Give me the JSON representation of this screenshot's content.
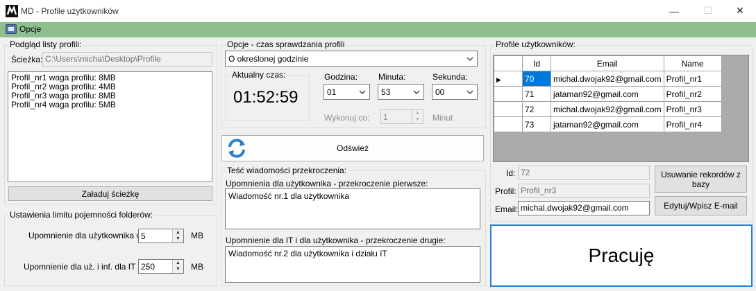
{
  "window": {
    "title": "MD - Profile użytkowników",
    "minimize_glyph": "—",
    "maximize_glyph": "☐",
    "close_glyph": "✕"
  },
  "menu": {
    "options_label": "Opcje"
  },
  "profiles_preview": {
    "group_title": "Podgląd listy profili:",
    "path_label": "Ścieżka:",
    "path_value": "C:\\Users\\micha\\Desktop\\Profile",
    "list_items": [
      "Profil_nr1 waga profilu: 8MB",
      "Profil_nr2 waga profilu: 4MB",
      "Profil_nr3 waga profilu: 8MB",
      "Profil_nr4 waga profilu: 5MB"
    ],
    "load_button": "Załaduj ścieżkę"
  },
  "limits": {
    "group_title": "Ustawienia limitu pojemności folderów:",
    "user_warning_label": "Upomnienie dla użytkownika od:",
    "user_warning_value": "5",
    "user_warning_unit": "MB",
    "it_warning_label": "Upomnienie dla uż. i inf. dla IT od:",
    "it_warning_value": "250",
    "it_warning_unit": "MB"
  },
  "check_options": {
    "group_title": "Opcje - czas sprawdzania profili",
    "mode_value": "O określonej godzinie",
    "current_time_label": "Aktualny czas:",
    "current_time_value": "01:52:59",
    "hour_label": "Godzina:",
    "hour_value": "01",
    "minute_label": "Minuta:",
    "minute_value": "53",
    "second_label": "Sekunda:",
    "second_value": "00",
    "every_label": "Wykonuj co:",
    "every_value": "1",
    "every_unit": "Minut"
  },
  "refresh": {
    "label": "Odśwież"
  },
  "messages": {
    "group_title": "Teść wiadomości przekroczenia:",
    "first_label": "Upomnienia dla użytkownika - przekroczenie pierwsze:",
    "first_value": "Wiadomość nr.1 dla użytkownika",
    "second_label": "Upomnienie dla IT i dla użytkownika - przekroczenie drugie:",
    "second_value": "Wiadomość nr.2 dla użytkownika i działu IT"
  },
  "users": {
    "group_title": "Profile użytkowników:",
    "columns": [
      "Id",
      "Email",
      "Name"
    ],
    "rows": [
      {
        "id": "70",
        "email": "michal.dwojak92@gmail.com",
        "name": "Profil_nr1"
      },
      {
        "id": "71",
        "email": "jataman92@gmail.com",
        "name": "Profil_nr2"
      },
      {
        "id": "72",
        "email": "michal.dwojak92@gmail.com",
        "name": "Profil_nr3"
      },
      {
        "id": "73",
        "email": "jataman92@gmail.com",
        "name": "Profil_nr4"
      }
    ],
    "id_label": "Id:",
    "id_value": "72",
    "profile_label": "Profil:",
    "profile_value": "Profil_nr3",
    "email_label": "Email:",
    "email_value": "michal.dwojak92@gmail.com",
    "delete_button": "Usuwanie rekordów z bazy",
    "edit_button": "Edytuj/Wpisz E-mail"
  },
  "status": {
    "label": "Pracuję"
  }
}
